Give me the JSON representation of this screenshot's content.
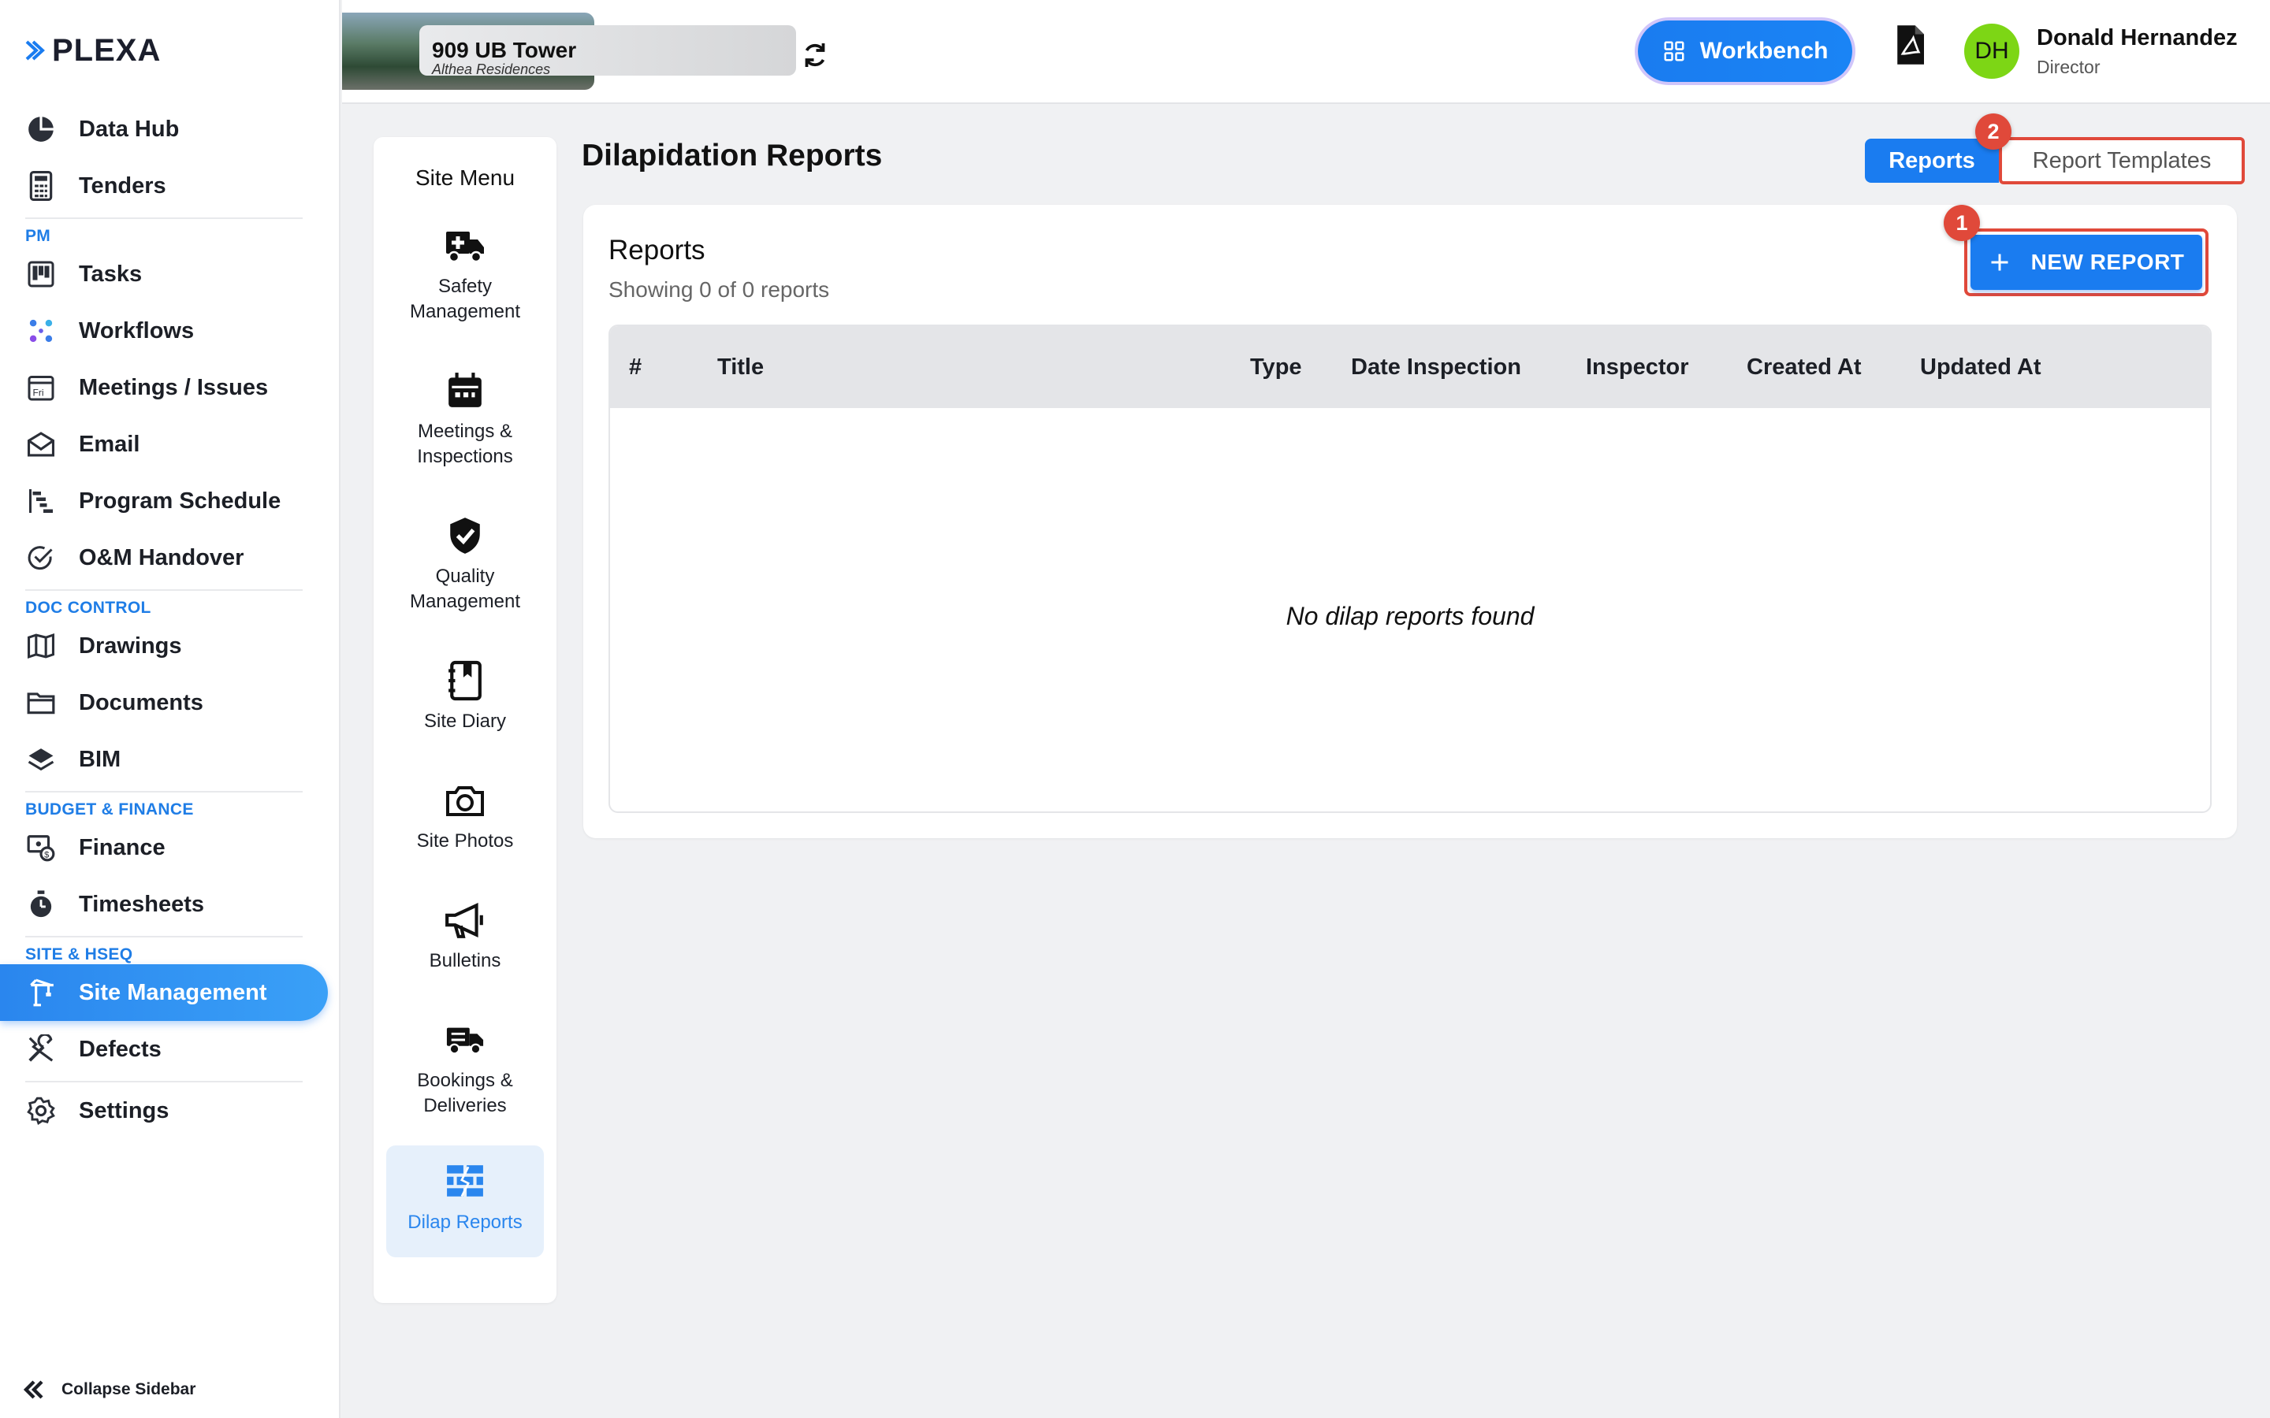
{
  "app": {
    "logo_text": "PLEXA"
  },
  "sidebar": {
    "items_top": [
      {
        "label": "Data Hub",
        "icon": "pie-chart-icon"
      },
      {
        "label": "Tenders",
        "icon": "calculator-icon"
      }
    ],
    "section_pm": "PM",
    "items_pm": [
      {
        "label": "Tasks",
        "icon": "kanban-icon"
      },
      {
        "label": "Workflows",
        "icon": "workflow-icon"
      },
      {
        "label": "Meetings / Issues",
        "icon": "calendar-icon"
      },
      {
        "label": "Email",
        "icon": "email-icon"
      },
      {
        "label": "Program Schedule",
        "icon": "gantt-icon"
      },
      {
        "label": "O&M Handover",
        "icon": "check-circle-icon"
      }
    ],
    "section_doc": "DOC CONTROL",
    "items_doc": [
      {
        "label": "Drawings",
        "icon": "map-icon"
      },
      {
        "label": "Documents",
        "icon": "folder-icon"
      },
      {
        "label": "BIM",
        "icon": "layers-icon"
      }
    ],
    "section_budget": "BUDGET & FINANCE",
    "items_budget": [
      {
        "label": "Finance",
        "icon": "money-icon"
      },
      {
        "label": "Timesheets",
        "icon": "stopwatch-icon"
      }
    ],
    "section_site": "SITE & HSEQ",
    "items_site": [
      {
        "label": "Site Management",
        "icon": "crane-icon",
        "active": true
      },
      {
        "label": "Defects",
        "icon": "tools-icon"
      },
      {
        "label": "Settings",
        "icon": "gear-icon"
      }
    ],
    "collapse_label": "Collapse Sidebar"
  },
  "topbar": {
    "project_name": "909 UB Tower",
    "project_sub": "Althea Residences",
    "workbench_label": "Workbench",
    "user_initials": "DH",
    "user_name": "Donald Hernandez",
    "user_role": "Director",
    "avatar_color": "#7dd615"
  },
  "site_menu": {
    "title": "Site Menu",
    "items": [
      {
        "label": "Safety Management",
        "icon": "ambulance-icon"
      },
      {
        "label": "Meetings & Inspections",
        "icon": "calendar-icon"
      },
      {
        "label": "Quality Management",
        "icon": "shield-check-icon"
      },
      {
        "label": "Site Diary",
        "icon": "diary-icon"
      },
      {
        "label": "Site Photos",
        "icon": "camera-icon"
      },
      {
        "label": "Bulletins",
        "icon": "megaphone-icon"
      },
      {
        "label": "Bookings & Deliveries",
        "icon": "truck-icon"
      },
      {
        "label": "Dilap Reports",
        "icon": "brick-wall-icon",
        "active": true
      }
    ]
  },
  "main": {
    "page_title": "Dilapidation Reports",
    "tab_reports": "Reports",
    "tab_templates": "Report Templates",
    "badge_1": "1",
    "badge_2": "2",
    "card_title": "Reports",
    "card_subtitle": "Showing 0 of 0 reports",
    "new_report_label": "NEW REPORT",
    "columns": [
      "#",
      "Title",
      "Type",
      "Date Inspection",
      "Inspector",
      "Created At",
      "Updated At"
    ],
    "empty_message": "No dilap reports found"
  },
  "colors": {
    "accent": "#1a7cf0",
    "highlight": "#e0493a"
  }
}
